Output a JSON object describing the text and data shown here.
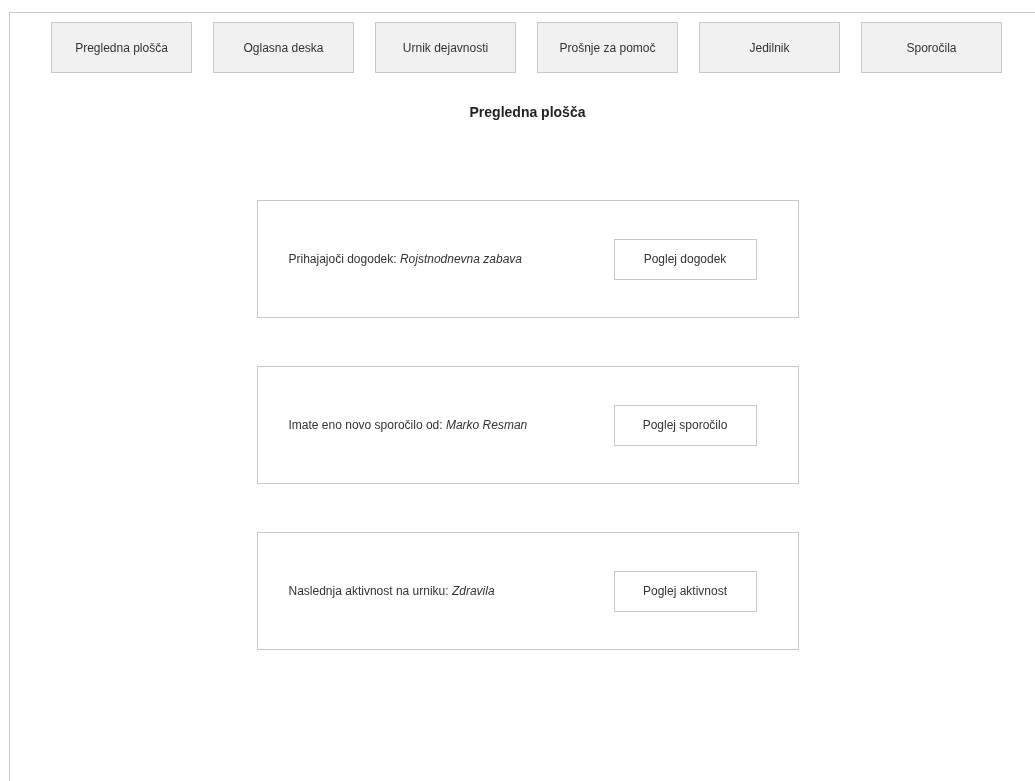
{
  "nav": [
    "Pregledna plošča",
    "Oglasna deska",
    "Urnik dejavnosti",
    "Prošnje za pomoč",
    "Jedilnik",
    "Sporočila"
  ],
  "page_title": "Pregledna plošča",
  "cards": [
    {
      "text": "Prihajajoči dogodek: *Rojstnodnevna zabava*",
      "button": "Poglej dogodek"
    },
    {
      "text": "Imate eno novo sporočilo od: *Marko Resman*",
      "button": "Poglej sporočilo"
    },
    {
      "text": "Naslednja aktivnost na urniku: *Zdravila*",
      "button": "Poglej aktivnost"
    }
  ]
}
